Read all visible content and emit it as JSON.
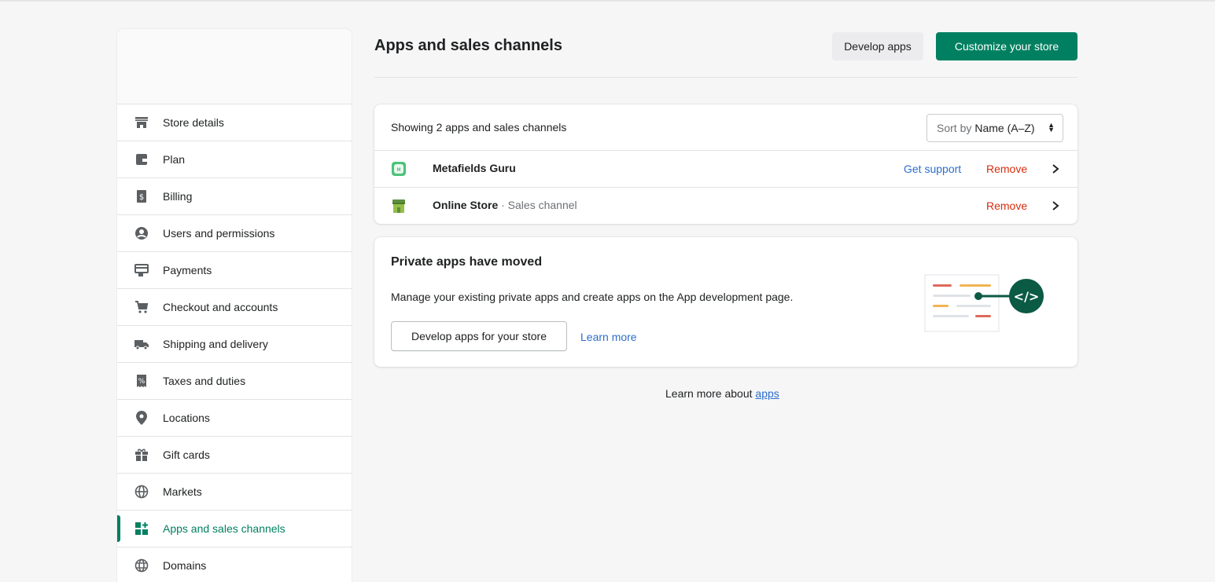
{
  "sidebar": {
    "items": [
      {
        "label": "Store details",
        "icon": "store-icon"
      },
      {
        "label": "Plan",
        "icon": "plan-icon"
      },
      {
        "label": "Billing",
        "icon": "billing-icon"
      },
      {
        "label": "Users and permissions",
        "icon": "user-icon"
      },
      {
        "label": "Payments",
        "icon": "payments-icon"
      },
      {
        "label": "Checkout and accounts",
        "icon": "cart-icon"
      },
      {
        "label": "Shipping and delivery",
        "icon": "truck-icon"
      },
      {
        "label": "Taxes and duties",
        "icon": "tax-icon"
      },
      {
        "label": "Locations",
        "icon": "location-pin-icon"
      },
      {
        "label": "Gift cards",
        "icon": "gift-icon"
      },
      {
        "label": "Markets",
        "icon": "globe-icon"
      },
      {
        "label": "Apps and sales channels",
        "icon": "apps-icon",
        "active": true
      },
      {
        "label": "Domains",
        "icon": "domain-globe-icon"
      }
    ]
  },
  "header": {
    "title": "Apps and sales channels",
    "develop_apps_label": "Develop apps",
    "customize_label": "Customize your store"
  },
  "apps_card": {
    "showing_text": "Showing 2 apps and sales channels",
    "sort_prefix": "Sort by",
    "sort_value": "Name (A–Z)",
    "apps": [
      {
        "name": "Metafields Guru",
        "subtitle": "",
        "support_label": "Get support",
        "remove_label": "Remove",
        "icon": "metafields-app-icon"
      },
      {
        "name": "Online Store",
        "subtitle": "· Sales channel",
        "remove_label": "Remove",
        "icon": "online-store-icon"
      }
    ]
  },
  "private_apps": {
    "title": "Private apps have moved",
    "text": "Manage your existing private apps and create apps on the App development page.",
    "button_label": "Develop apps for your store",
    "learn_more_label": "Learn more"
  },
  "footer": {
    "prefix": "Learn more about",
    "link": "apps"
  },
  "colors": {
    "accent": "#008060",
    "link": "#2c6ecb",
    "critical": "#d72c0d",
    "background": "#f6f6f7"
  }
}
